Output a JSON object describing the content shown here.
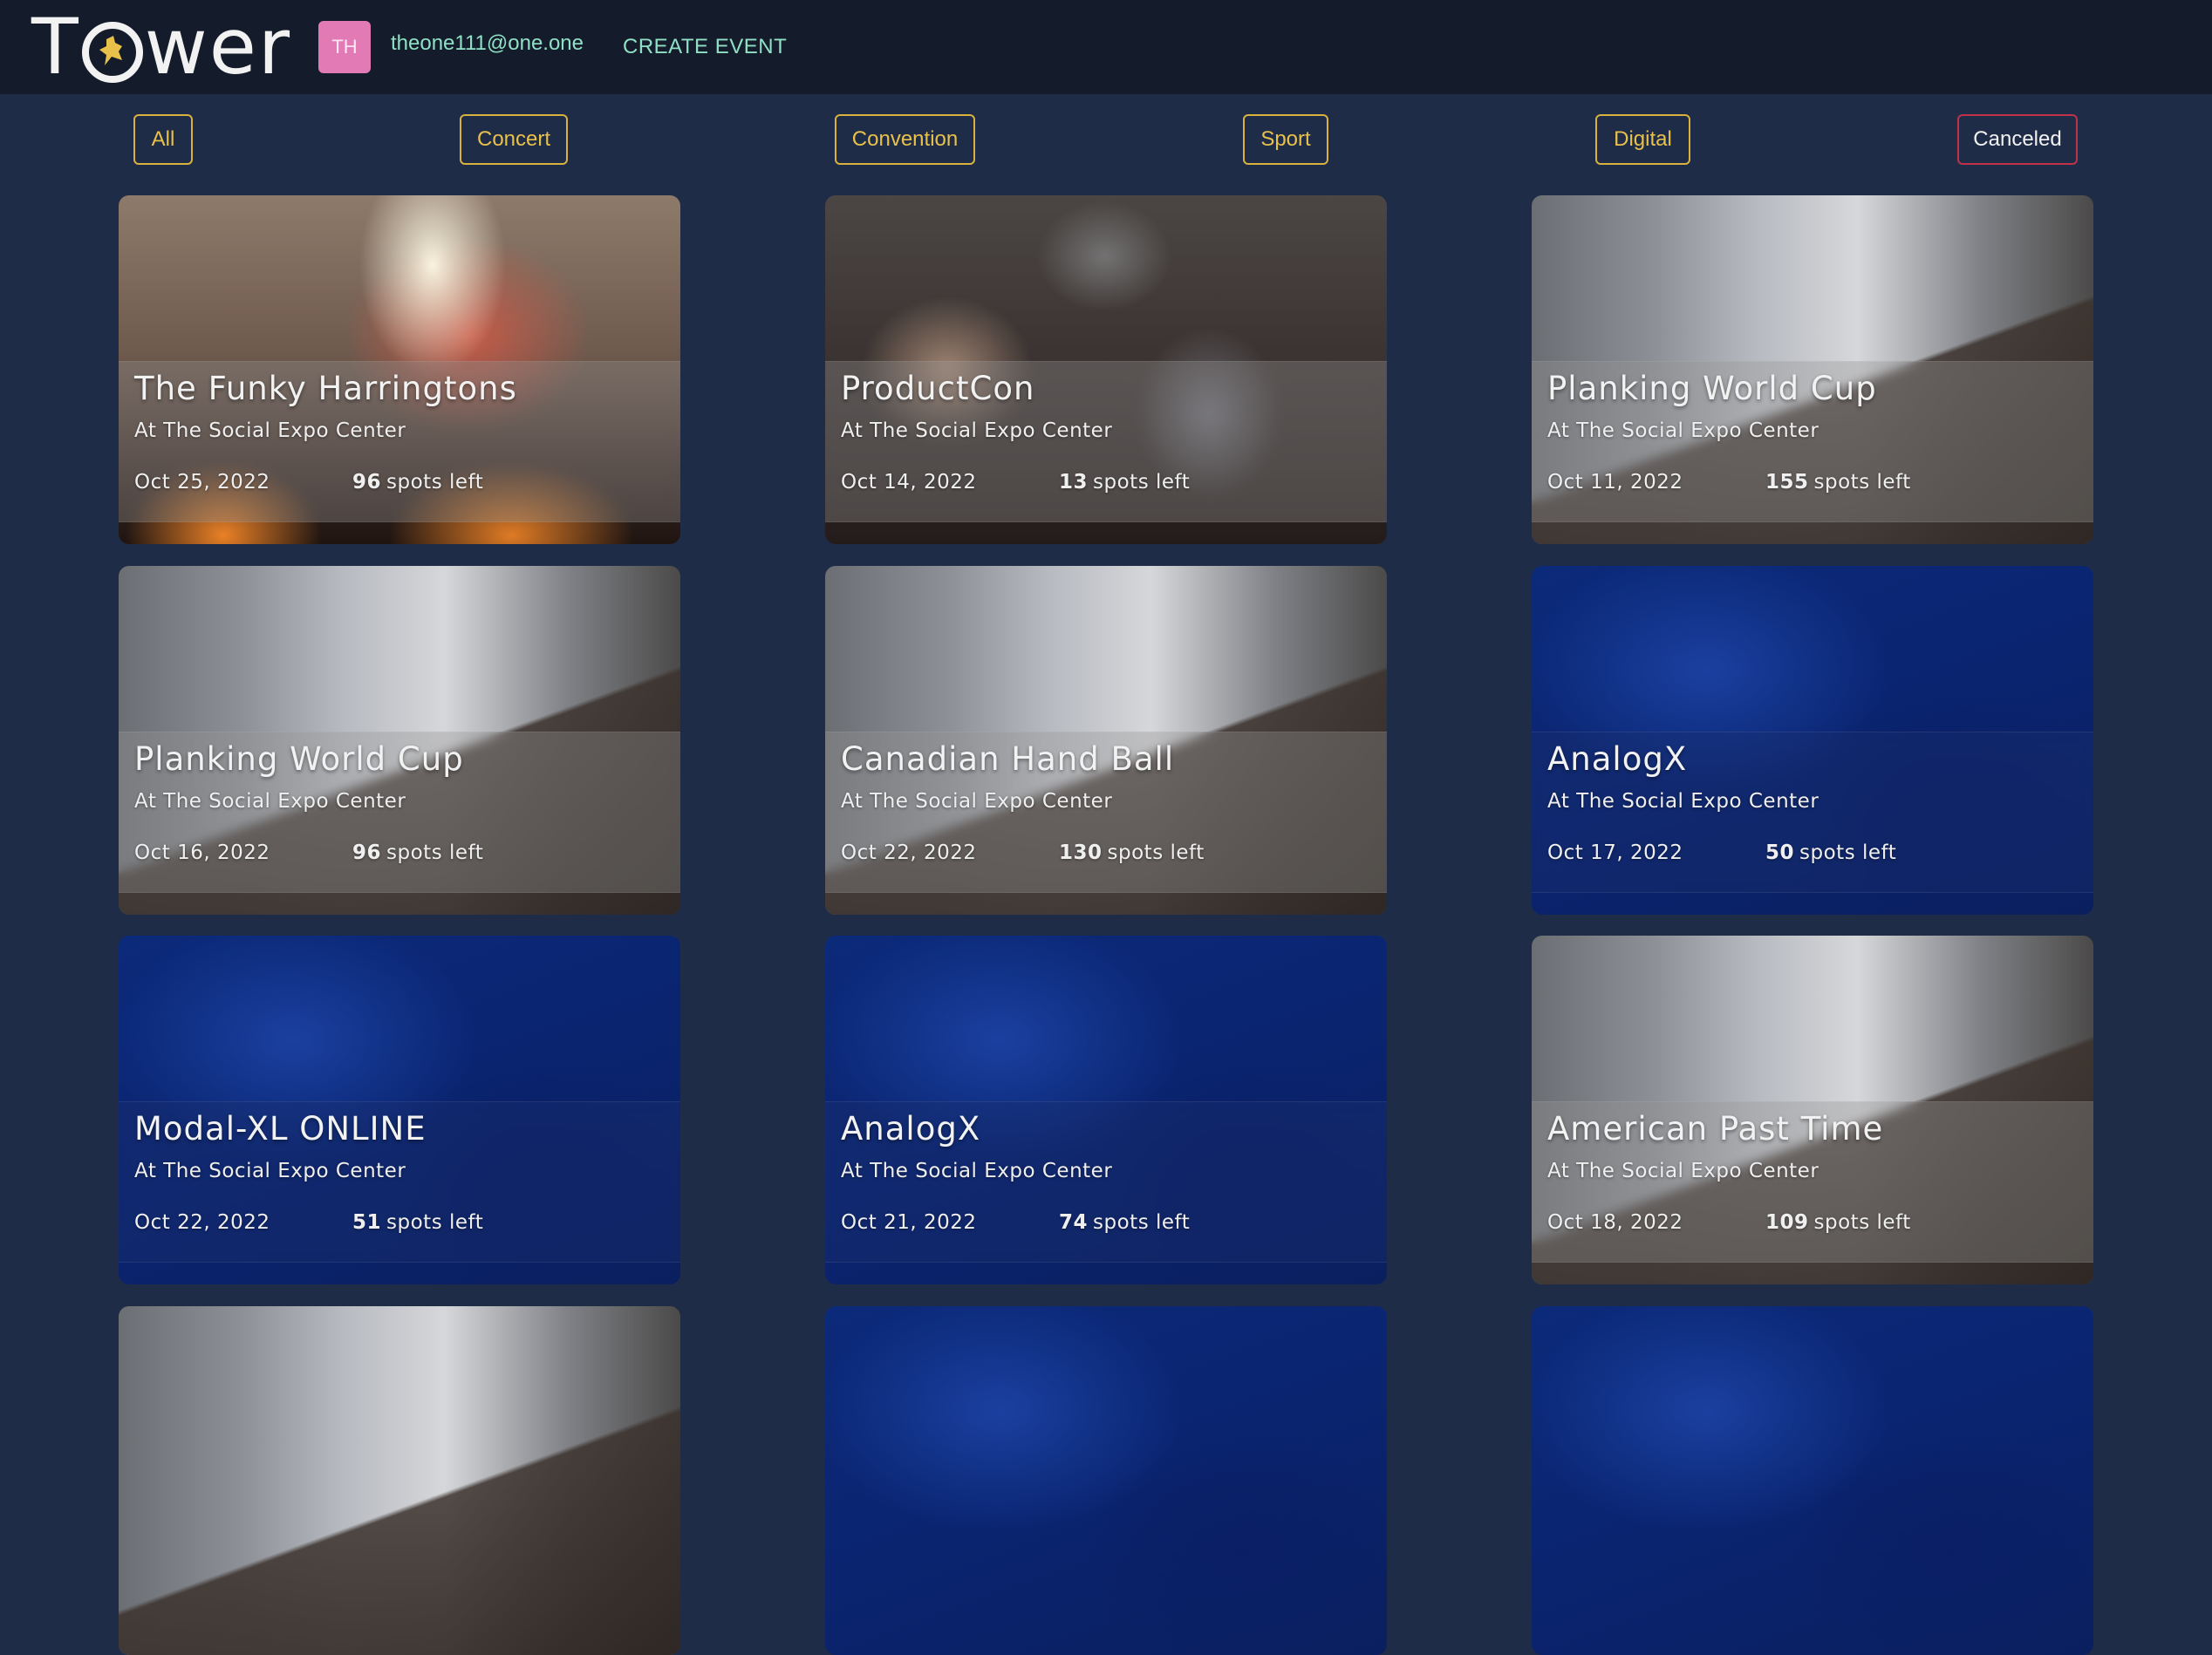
{
  "header": {
    "logo_text": "Tower",
    "avatar_initials": "TH",
    "user_email": "theone111@one.one",
    "create_event_label": "CREATE EVENT"
  },
  "filters": [
    {
      "label": "All"
    },
    {
      "label": "Concert"
    },
    {
      "label": "Convention"
    },
    {
      "label": "Sport"
    },
    {
      "label": "Digital"
    },
    {
      "label": "Canceled"
    }
  ],
  "events": [
    {
      "title": "The Funky Harringtons",
      "location": "At The Social Expo Center",
      "date": "Oct 25, 2022",
      "spots": "96",
      "spots_suffix": "spots left",
      "image": "concert"
    },
    {
      "title": "ProductCon",
      "location": "At The Social Expo Center",
      "date": "Oct 14, 2022",
      "spots": "13",
      "spots_suffix": "spots left",
      "image": "convention"
    },
    {
      "title": "Planking World Cup",
      "location": "At The Social Expo Center",
      "date": "Oct 11, 2022",
      "spots": "155",
      "spots_suffix": "spots left",
      "image": "sport"
    },
    {
      "title": "Planking World Cup",
      "location": "At The Social Expo Center",
      "date": "Oct 16, 2022",
      "spots": "96",
      "spots_suffix": "spots left",
      "image": "sport"
    },
    {
      "title": "Canadian Hand Ball",
      "location": "At The Social Expo Center",
      "date": "Oct 22, 2022",
      "spots": "130",
      "spots_suffix": "spots left",
      "image": "sport"
    },
    {
      "title": "AnalogX",
      "location": "At The Social Expo Center",
      "date": "Oct 17, 2022",
      "spots": "50",
      "spots_suffix": "spots left",
      "image": "digital"
    },
    {
      "title": "Modal-XL ONLINE",
      "location": "At The Social Expo Center",
      "date": "Oct 22, 2022",
      "spots": "51",
      "spots_suffix": "spots left",
      "image": "digital"
    },
    {
      "title": "AnalogX",
      "location": "At The Social Expo Center",
      "date": "Oct 21, 2022",
      "spots": "74",
      "spots_suffix": "spots left",
      "image": "digital"
    },
    {
      "title": "American Past Time",
      "location": "At The Social Expo Center",
      "date": "Oct 18, 2022",
      "spots": "109",
      "spots_suffix": "spots left",
      "image": "sport"
    }
  ],
  "colors": {
    "page_bg": "#1f2c48",
    "header_bg": "#141b2b",
    "accent_green": "#8fe0c4",
    "filter_gold": "#d8b23c",
    "filter_danger": "#c0324a",
    "avatar_pink": "#e27ab5"
  }
}
